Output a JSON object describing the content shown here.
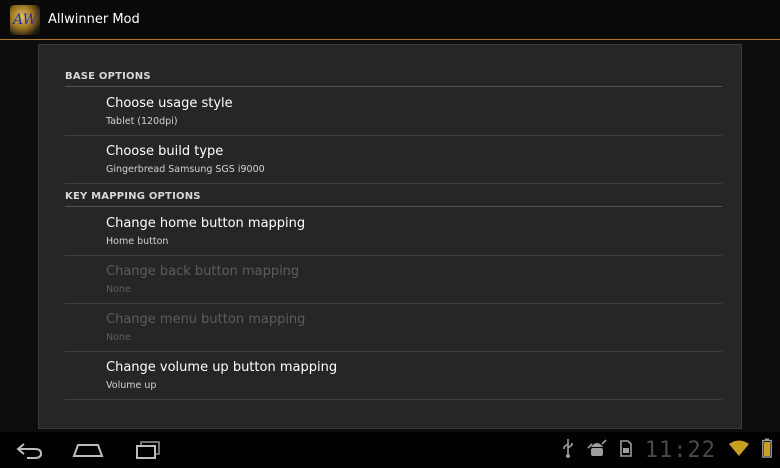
{
  "app": {
    "title": "Allwinner Mod",
    "logo_text": "AW"
  },
  "sections": [
    {
      "header": "BASE OPTIONS"
    },
    {
      "header": "KEY MAPPING OPTIONS"
    }
  ],
  "preferences": [
    {
      "title": "Choose usage style",
      "summary": "Tablet (120dpi)",
      "enabled": true
    },
    {
      "title": "Choose build type",
      "summary": "Gingerbread Samsung SGS i9000",
      "enabled": true
    },
    {
      "title": "Change home button mapping",
      "summary": "Home button",
      "enabled": true
    },
    {
      "title": "Change back button mapping",
      "summary": "None",
      "enabled": false
    },
    {
      "title": "Change menu button mapping",
      "summary": "None",
      "enabled": false
    },
    {
      "title": "Change volume up button mapping",
      "summary": "Volume up",
      "enabled": true
    }
  ],
  "navbar": {
    "buttons": [
      "back-icon",
      "home-icon",
      "recent-apps-icon"
    ]
  },
  "status": {
    "clock": "11:22",
    "icons": [
      "usb-icon",
      "android-debug-icon",
      "sd-card-icon",
      "wifi-icon",
      "battery-icon"
    ],
    "accent_color": "#c8a020"
  }
}
